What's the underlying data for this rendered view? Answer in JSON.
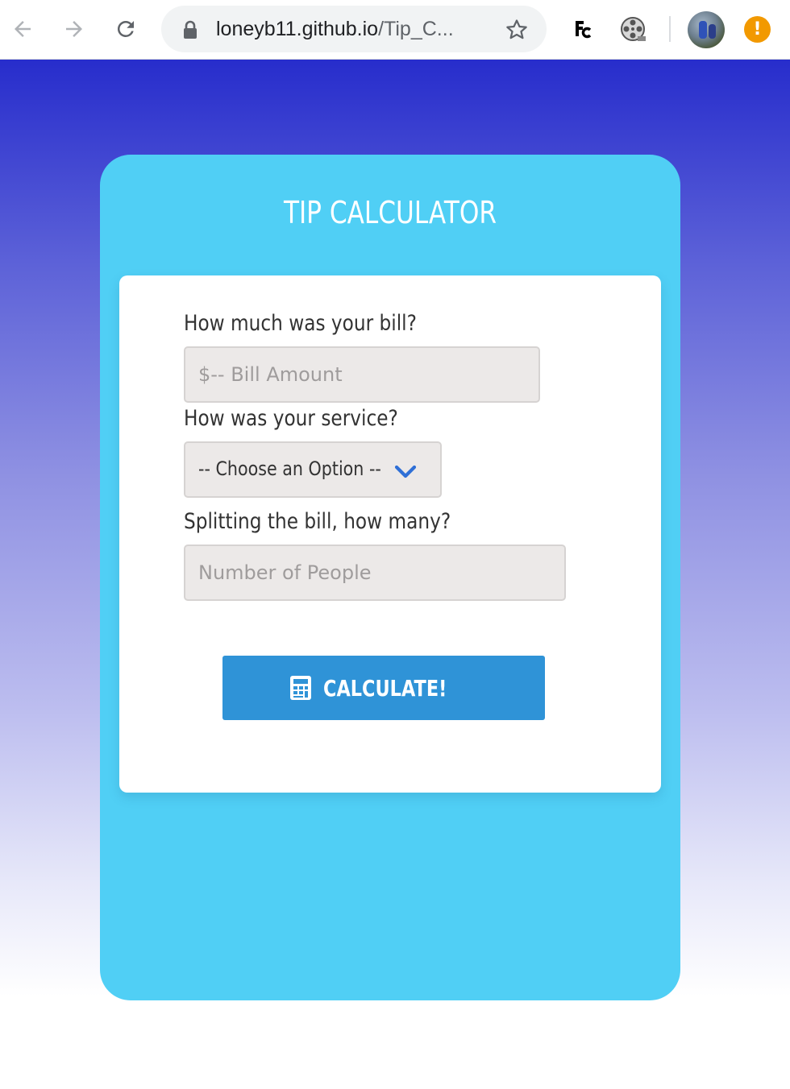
{
  "browser": {
    "url_host": "loneyb11.github.io",
    "url_path": "/Tip_C...",
    "extensions": [
      "fc-extension-icon",
      "film-reel-extension-icon"
    ],
    "alert_symbol": "!",
    "accent": "#f29900"
  },
  "app": {
    "title": "TIP CALCULATOR",
    "colors": {
      "background_top": "#272dcc",
      "card": "#50cff5",
      "button": "#2f93d7"
    },
    "bill": {
      "label": "How much was your bill?",
      "placeholder": "$-- Bill Amount",
      "value": ""
    },
    "service": {
      "label": "How was your service?",
      "selected": "-- Choose an Option --"
    },
    "people": {
      "label": "Splitting the bill, how many?",
      "placeholder": "Number of People",
      "value": ""
    },
    "calculate": {
      "label": "CALCULATE!",
      "icon": "calculator-icon"
    }
  }
}
